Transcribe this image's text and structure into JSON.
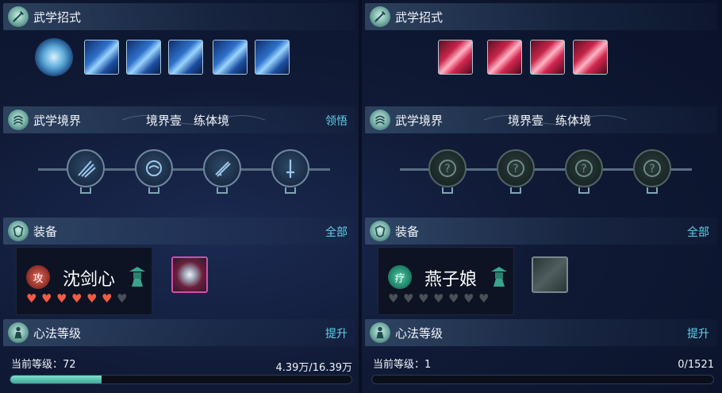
{
  "panels": [
    {
      "martial_moves": {
        "title": "武学招式",
        "skills": [
          "water-spiral",
          "blue-slash-1",
          "blue-slash-2",
          "blue-strike",
          "blue-light-pillar",
          "blue-dash"
        ]
      },
      "martial_realm": {
        "title": "武学境界",
        "realm_level": "境界壹",
        "realm_name": "练体境",
        "action": "领悟",
        "nodes": [
          "slash-node",
          "swirl-node",
          "blade-node",
          "sword-node"
        ]
      },
      "equipment": {
        "title": "装备",
        "action": "全部",
        "badge": "攻",
        "name": "沈剑心",
        "hearts_filled": 6,
        "hearts_total": 7,
        "item": "armor"
      },
      "heart_method": {
        "title": "心法等级",
        "action": "提升",
        "level_label": "当前等级：72",
        "exp_text": "4.39万/16.39万",
        "progress": 0.268
      }
    },
    {
      "martial_moves": {
        "title": "武学招式",
        "skills": [
          "red-slash-1",
          "red-slash-2",
          "red-vortex",
          "red-figure"
        ]
      },
      "martial_realm": {
        "title": "武学境界",
        "realm_level": "境界壹",
        "realm_name": "练体境",
        "action": "",
        "nodes": [
          "locked",
          "locked",
          "locked",
          "locked"
        ]
      },
      "equipment": {
        "title": "装备",
        "action": "全部",
        "badge": "疗",
        "name": "燕子娘",
        "hearts_filled": 0,
        "hearts_total": 7,
        "item": "empty"
      },
      "heart_method": {
        "title": "心法等级",
        "action": "提升",
        "level_label": "当前等级：1",
        "exp_text": "0/1521",
        "progress": 0
      }
    }
  ],
  "colors": {
    "link": "#5fd2ea",
    "heart_on": "#f25a45",
    "heart_off": "#4a4f58",
    "progress": "#5cc8b6"
  }
}
